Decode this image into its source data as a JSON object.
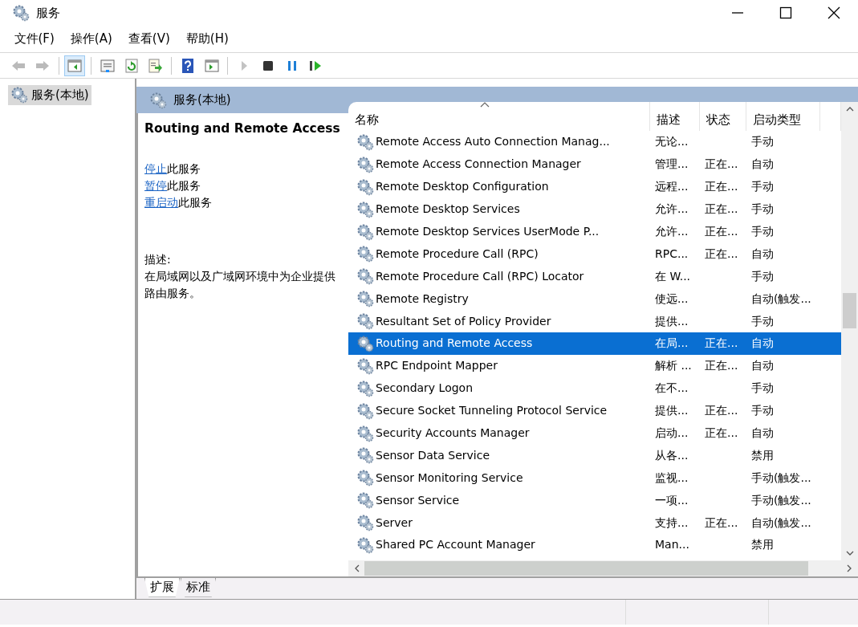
{
  "window": {
    "title": "服务"
  },
  "menu": [
    {
      "label": "文件(F)"
    },
    {
      "label": "操作(A)"
    },
    {
      "label": "查看(V)"
    },
    {
      "label": "帮助(H)"
    }
  ],
  "toolbar": [
    {
      "kind": "back",
      "disabled": true,
      "pressed": false
    },
    {
      "kind": "forward",
      "disabled": true,
      "pressed": false
    },
    {
      "kind": "sep"
    },
    {
      "kind": "tree",
      "disabled": false,
      "pressed": true
    },
    {
      "kind": "sep"
    },
    {
      "kind": "properties",
      "disabled": false,
      "pressed": false
    },
    {
      "kind": "refresh",
      "disabled": false,
      "pressed": false
    },
    {
      "kind": "export",
      "disabled": false,
      "pressed": false
    },
    {
      "kind": "sep"
    },
    {
      "kind": "help",
      "disabled": false,
      "pressed": false
    },
    {
      "kind": "pane",
      "disabled": false,
      "pressed": false
    },
    {
      "kind": "sep"
    },
    {
      "kind": "play",
      "disabled": true,
      "pressed": false
    },
    {
      "kind": "stop",
      "disabled": false,
      "pressed": false
    },
    {
      "kind": "pause",
      "disabled": false,
      "pressed": false
    },
    {
      "kind": "resume",
      "disabled": false,
      "pressed": false
    }
  ],
  "tree": [
    {
      "label": "服务(本地)",
      "selected": true
    }
  ],
  "pane_title": "服务(本地)",
  "detail": {
    "title": "Routing and Remote Access",
    "actions": [
      {
        "link": "停止",
        "text": "此服务"
      },
      {
        "link": "暂停",
        "text": "此服务"
      },
      {
        "link": "重启动",
        "text": "此服务"
      }
    ],
    "description_label": "描述:",
    "description": "在局域网以及广域网环境中为企业提供路由服务。"
  },
  "columns": [
    "名称",
    "描述",
    "状态",
    "启动类型"
  ],
  "rows": [
    {
      "name": "Remote Access Auto Connection Manag...",
      "description": "无论...",
      "startup": "手动",
      "selected": false
    },
    {
      "name": "Remote Access Connection Manager",
      "description": "管理...",
      "status": "正在...",
      "startup": "自动",
      "selected": false
    },
    {
      "name": "Remote Desktop Configuration",
      "description": "远程...",
      "status": "正在...",
      "startup": "手动",
      "selected": false
    },
    {
      "name": "Remote Desktop Services",
      "description": "允许...",
      "status": "正在...",
      "startup": "手动",
      "selected": false
    },
    {
      "name": "Remote Desktop Services UserMode P...",
      "description": "允许...",
      "status": "正在...",
      "startup": "手动",
      "selected": false
    },
    {
      "name": "Remote Procedure Call (RPC)",
      "description": "RPC...",
      "status": "正在...",
      "startup": "自动",
      "selected": false
    },
    {
      "name": "Remote Procedure Call (RPC) Locator",
      "description": "在 W...",
      "startup": "手动",
      "selected": false
    },
    {
      "name": "Remote Registry",
      "description": "使远...",
      "startup": "自动(触发...",
      "selected": false
    },
    {
      "name": "Resultant Set of Policy Provider",
      "description": "提供...",
      "startup": "手动",
      "selected": false
    },
    {
      "name": "Routing and Remote Access",
      "description": "在局...",
      "status": "正在...",
      "startup": "自动",
      "selected": true
    },
    {
      "name": "RPC Endpoint Mapper",
      "description": "解析 ...",
      "status": "正在...",
      "startup": "自动",
      "selected": false
    },
    {
      "name": "Secondary Logon",
      "description": "在不...",
      "startup": "手动",
      "selected": false
    },
    {
      "name": "Secure Socket Tunneling Protocol Service",
      "description": "提供...",
      "status": "正在...",
      "startup": "手动",
      "selected": false
    },
    {
      "name": "Security Accounts Manager",
      "description": "启动...",
      "status": "正在...",
      "startup": "自动",
      "selected": false
    },
    {
      "name": "Sensor Data Service",
      "description": "从各...",
      "startup": "禁用",
      "selected": false
    },
    {
      "name": "Sensor Monitoring Service",
      "description": "监视...",
      "startup": "手动(触发...",
      "selected": false
    },
    {
      "name": "Sensor Service",
      "description": "一项...",
      "startup": "手动(触发...",
      "selected": false
    },
    {
      "name": "Server",
      "description": "支持...",
      "status": "正在...",
      "startup": "自动(触发...",
      "selected": false
    },
    {
      "name": "Shared PC Account Manager",
      "description": "Man...",
      "startup": "禁用",
      "selected": false
    }
  ],
  "bottom_tabs": [
    {
      "label": "扩展",
      "selected": true
    },
    {
      "label": "标准",
      "selected": false
    }
  ]
}
